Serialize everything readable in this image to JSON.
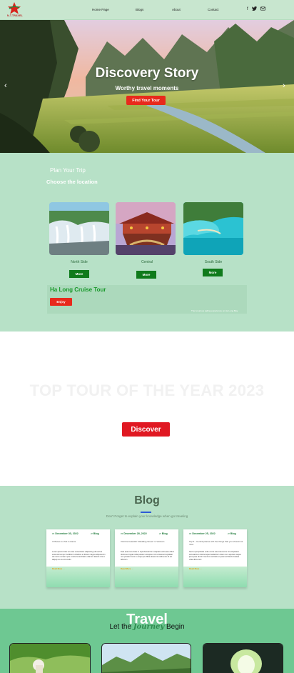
{
  "nav": {
    "logo_text": "N.T.TRAVEL",
    "links": [
      "Home Page",
      "Blogs",
      "About",
      "Contact"
    ],
    "icons": [
      "facebook-icon",
      "twitter-icon",
      "mail-icon"
    ]
  },
  "hero": {
    "title": "Discovery Story",
    "subtitle": "Worthy travel moments",
    "button": "Find Your Tour",
    "prev_arrow": "‹",
    "next_arrow": "›"
  },
  "plan": {
    "title": "Plan Your Trip",
    "subtitle": "Choose the location",
    "locations": [
      {
        "label": "North Side",
        "button": "More"
      },
      {
        "label": "Central",
        "button": "More"
      },
      {
        "label": "South Side",
        "button": "More"
      }
    ],
    "cruise_title": "Ha Long Cruise Tour",
    "cruise_button": "Enjoy",
    "cruise_note": "The luxurious sailing experience on Ha Long Bay"
  },
  "toptour": {
    "title": "TOP TOUR OF THE YEAR 2023",
    "button": "Discover"
  },
  "blog": {
    "title": "Blog",
    "subtitle": "Don't Forget to explain your knowledge when go traveling",
    "cards": [
      {
        "date": "December 30, 2022",
        "category": "Blog",
        "title": "3 Places to Visit in Hanoi",
        "excerpt": "Lorem ipsum dolor sit amet consectetur adipiscing elit sed do eiusmod tempor incididunt ut labore et dolore magna aliqua enim ad minim veniam quis nostrud exercitation ullamco laboris nisi ut aliquip ex ea commodo",
        "more": "Read More →"
      },
      {
        "date": "December 28, 2022",
        "category": "Blog",
        "title": "Visit the beautiful \"Wedding Street\" in Vietnam",
        "excerpt": "Duis aute irure dolor in reprehenderit in voluptate velit esse cillum dolore eu fugiat nulla pariatur excepteur sint occaecat cupidatat non proident sunt in culpa qui officia deserunt mollit anim id est laborum",
        "more": "Read More →"
      },
      {
        "date": "December 25, 2022",
        "category": "Blog",
        "title": "Top 5 - Central places with the things that you should not miss",
        "excerpt": "Sed ut perspiciatis unde omnis iste natus error sit voluptatem accusantium doloremque laudantium totam rem aperiam eaque ipsa quae ab illo inventore veritatis et quasi architecto beatae vitae dicta sunt",
        "more": "Read More →"
      }
    ]
  },
  "travel": {
    "big": "Travel",
    "sub_before": "Let the",
    "sub_em": "Journey",
    "sub_after": "Begin"
  }
}
